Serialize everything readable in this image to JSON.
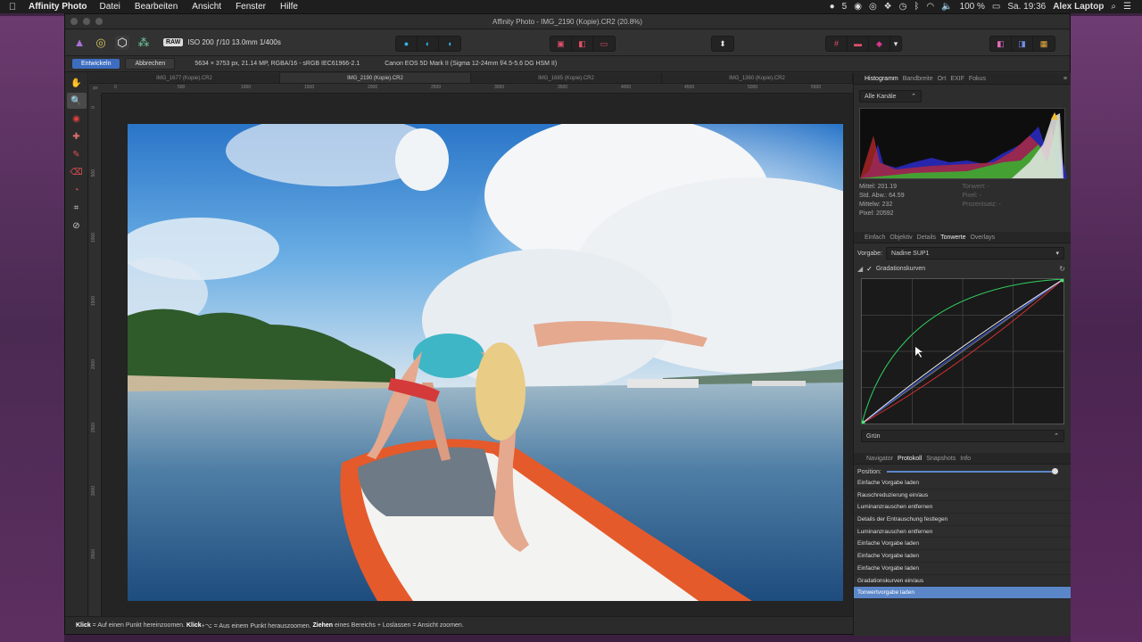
{
  "menubar": {
    "app_name": "Affinity Photo",
    "items": [
      "Datei",
      "Bearbeiten",
      "Ansicht",
      "Fenster",
      "Hilfe"
    ],
    "badge_count": "5",
    "battery": "100 %",
    "clock": "Sa. 19:36",
    "user": "Alex Laptop"
  },
  "window": {
    "title": "Affinity Photo - IMG_2190 (Kopie).CR2 (20.8%)"
  },
  "toolbar": {
    "raw_label": "RAW",
    "exif": "ISO 200 ƒ/10 13.0mm 1/400s"
  },
  "context": {
    "develop_label": "Entwickeln",
    "cancel_label": "Abbrechen",
    "image_info": "5634 × 3753 px, 21.14 MP, RGBA/16 - sRGB IEC61966-2.1",
    "camera_info": "Canon EOS 5D Mark II (Sigma 12-24mm f/4.5-5.6 DG HSM II)"
  },
  "doc_tabs": [
    "IMG_1677 (Kopie).CR2",
    "IMG_2190 (Kopie).CR2",
    "IMG_1685 (Kopie).CR2",
    "IMG_1360 (Kopie).CR2"
  ],
  "ruler": {
    "unit": "px",
    "h_ticks": [
      "0",
      "500",
      "1000",
      "1500",
      "2000",
      "2500",
      "3000",
      "3500",
      "4000",
      "4500",
      "5000",
      "5500"
    ],
    "v_ticks": [
      "0",
      "500",
      "1000",
      "1500",
      "2000",
      "2500",
      "3000",
      "3500"
    ]
  },
  "status": {
    "k1": "Klick",
    "t1": " = Auf einen Punkt hereinzoomen. ",
    "k2": "Klick",
    "t2": "+⌥ = Aus einem Punkt herauszoomen. ",
    "k3": "Ziehen",
    "t3": " eines Bereichs + Loslassen = Ansicht zoomen."
  },
  "histogram": {
    "tabs": [
      "Histogramm",
      "Bandbreite",
      "Ort",
      "EXIF",
      "Fokus"
    ],
    "channel": "Alle Kanäle",
    "stats_left": [
      "Mittel: 201.19",
      "Std. Abw.: 64.59",
      "Mittelw: 232",
      "Pixel: 20592"
    ],
    "stats_right": [
      "Tonwert: -",
      "Pixel: -",
      "Prozentsatz: -"
    ]
  },
  "develop": {
    "tabs": [
      "Einfach",
      "Objektiv",
      "Details",
      "Tonwerte",
      "Overlays"
    ],
    "preset_label": "Vorgabe:",
    "preset_value": "Nadine SUP1",
    "curves_label": "Gradationskurven",
    "channel": "Grün"
  },
  "history": {
    "tabs": [
      "Navigator",
      "Protokoll",
      "Snapshots",
      "Info"
    ],
    "position_label": "Position:",
    "items": [
      "Einfache Vorgabe laden",
      "Rauschreduzierung ein/aus",
      "Luminanzrauschen entfernen",
      "Details der Entrauschung festlegen",
      "Luminanzrauschen entfernen",
      "Einfache Vorgabe laden",
      "Einfache Vorgabe laden",
      "Einfache Vorgabe laden",
      "Gradationskurven ein/aus",
      "Tonwertvorgabe laden"
    ]
  },
  "colors": {
    "accent": "#5b87c9",
    "develop_button": "#3d6dbf"
  }
}
